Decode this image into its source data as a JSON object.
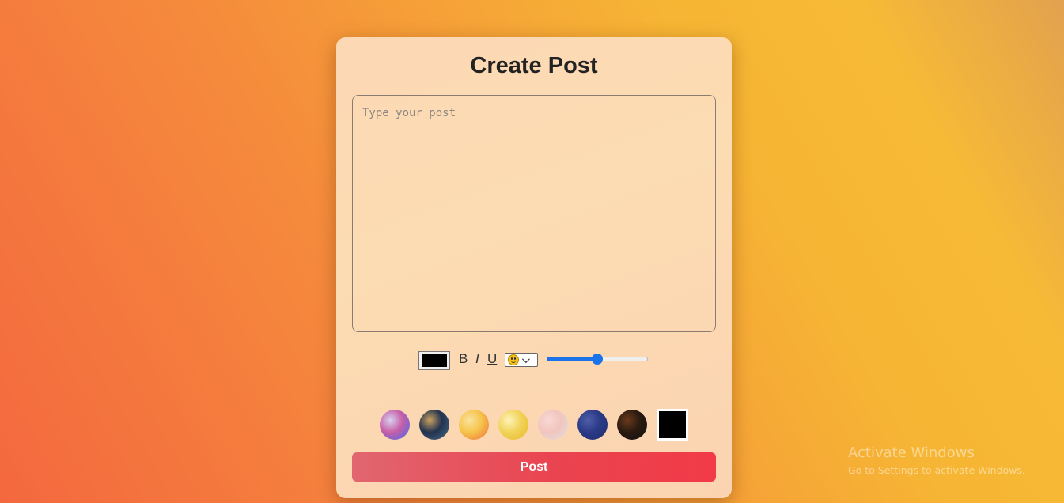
{
  "page": {
    "background_gradient": [
      "#f4683f",
      "#f6b534",
      "#e2a14e"
    ]
  },
  "card": {
    "title": "Create Post"
  },
  "editor": {
    "placeholder": "Type your post",
    "value": ""
  },
  "toolbar": {
    "text_color": "#000000",
    "bold_label": "B",
    "italic_label": "I",
    "underline_label": "U",
    "emoji_selected": "smiley-face-emoji",
    "font_size_slider": {
      "min": 0,
      "max": 100,
      "value": 50,
      "accent_color": "#1a73e8"
    }
  },
  "backgrounds": {
    "options": [
      {
        "name": "bg-option-abstract-pink-blue",
        "colors": [
          "#c85ea7",
          "#3b6bf0",
          "#d6d0ef"
        ],
        "selected": false
      },
      {
        "name": "bg-option-night-sky",
        "colors": [
          "#22334f",
          "#4a6a8a",
          "#c8a060"
        ],
        "selected": false
      },
      {
        "name": "bg-option-autumn-leaves",
        "colors": [
          "#f6c44a",
          "#ee6d3d",
          "#fbe2a0"
        ],
        "selected": false
      },
      {
        "name": "bg-option-golden-flowers",
        "colors": [
          "#f1d35a",
          "#e7b823",
          "#fff2b8"
        ],
        "selected": false
      },
      {
        "name": "bg-option-pastel-pink",
        "colors": [
          "#f2c5bf",
          "#dfdede",
          "#f8d8d3"
        ],
        "selected": false
      },
      {
        "name": "bg-option-starry-navy",
        "colors": [
          "#2b3a86",
          "#1e2d6d",
          "#4e5ea8"
        ],
        "selected": false
      },
      {
        "name": "bg-option-dark-pattern",
        "colors": [
          "#2a1a10",
          "#111111",
          "#6b3a1c"
        ],
        "selected": false
      },
      {
        "name": "bg-option-solid-black",
        "colors": [
          "#000000"
        ],
        "selected": true
      }
    ]
  },
  "actions": {
    "post_label": "Post",
    "post_gradient": [
      "#e16670",
      "#f23a48"
    ]
  },
  "watermark": {
    "title": "Activate Windows",
    "subtitle": "Go to Settings to activate Windows."
  }
}
